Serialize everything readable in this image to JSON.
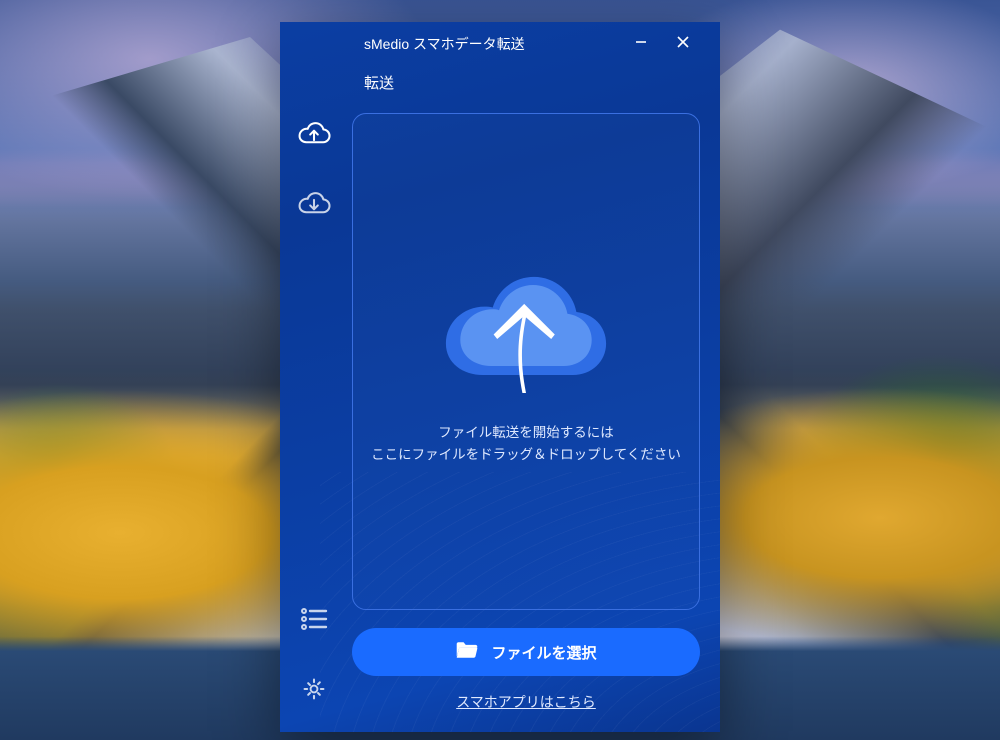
{
  "window": {
    "title": "sMedio スマホデータ転送"
  },
  "tabs": {
    "transfer": "転送"
  },
  "sidebar": {
    "items": [
      {
        "name": "upload",
        "icon": "cloud-upload-icon",
        "active": true
      },
      {
        "name": "download",
        "icon": "cloud-download-icon",
        "active": false
      }
    ],
    "bottom": [
      {
        "name": "history",
        "icon": "list-icon"
      },
      {
        "name": "settings",
        "icon": "gear-icon"
      }
    ]
  },
  "dropzone": {
    "line1": "ファイル転送を開始するには",
    "line2": "ここにファイルをドラッグ＆ドロップしてください"
  },
  "actions": {
    "select_file": "ファイルを選択"
  },
  "links": {
    "app_link": "スマホアプリはこちら"
  },
  "colors": {
    "accent": "#1a6bff",
    "panel_start": "#0b3ea3",
    "panel_end": "#0c45b2",
    "border": "#3a6fe0"
  }
}
